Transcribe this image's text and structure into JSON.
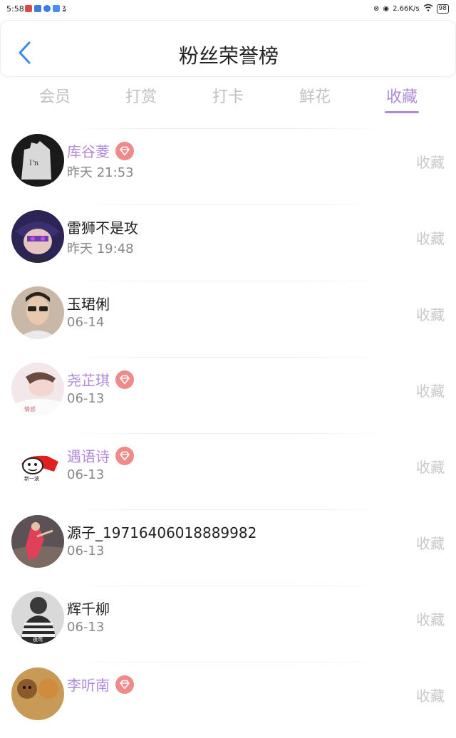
{
  "status_bar": {
    "time": "5:58",
    "speed": "2.66K/s",
    "battery": "98"
  },
  "header": {
    "title": "粉丝荣誉榜"
  },
  "tabs": [
    {
      "label": "会员"
    },
    {
      "label": "打赏"
    },
    {
      "label": "打卡"
    },
    {
      "label": "鲜花"
    },
    {
      "label": "收藏"
    }
  ],
  "active_tab": "收藏",
  "fans": [
    {
      "name": "库谷菱",
      "time": "昨天 21:53",
      "vip": true,
      "action": "收藏"
    },
    {
      "name": "雷狮不是攻",
      "time": "昨天 19:48",
      "vip": false,
      "action": "收藏"
    },
    {
      "name": "玉珺俐",
      "time": "06-14",
      "vip": false,
      "action": "收藏"
    },
    {
      "name": "尧芷琪",
      "time": "06-13",
      "vip": true,
      "action": "收藏"
    },
    {
      "name": "遇语诗",
      "time": "06-13",
      "vip": true,
      "action": "收藏"
    },
    {
      "name": "源子_19716406018889982",
      "time": "06-13",
      "vip": false,
      "action": "收藏"
    },
    {
      "name": "辉千柳",
      "time": "06-13",
      "vip": false,
      "action": "收藏"
    },
    {
      "name": "李听南",
      "time": "",
      "vip": true,
      "action": "收藏"
    }
  ],
  "colors": {
    "accent": "#b08ad8",
    "vip_badge": "#f08a8a",
    "muted": "#c8c8c8"
  }
}
